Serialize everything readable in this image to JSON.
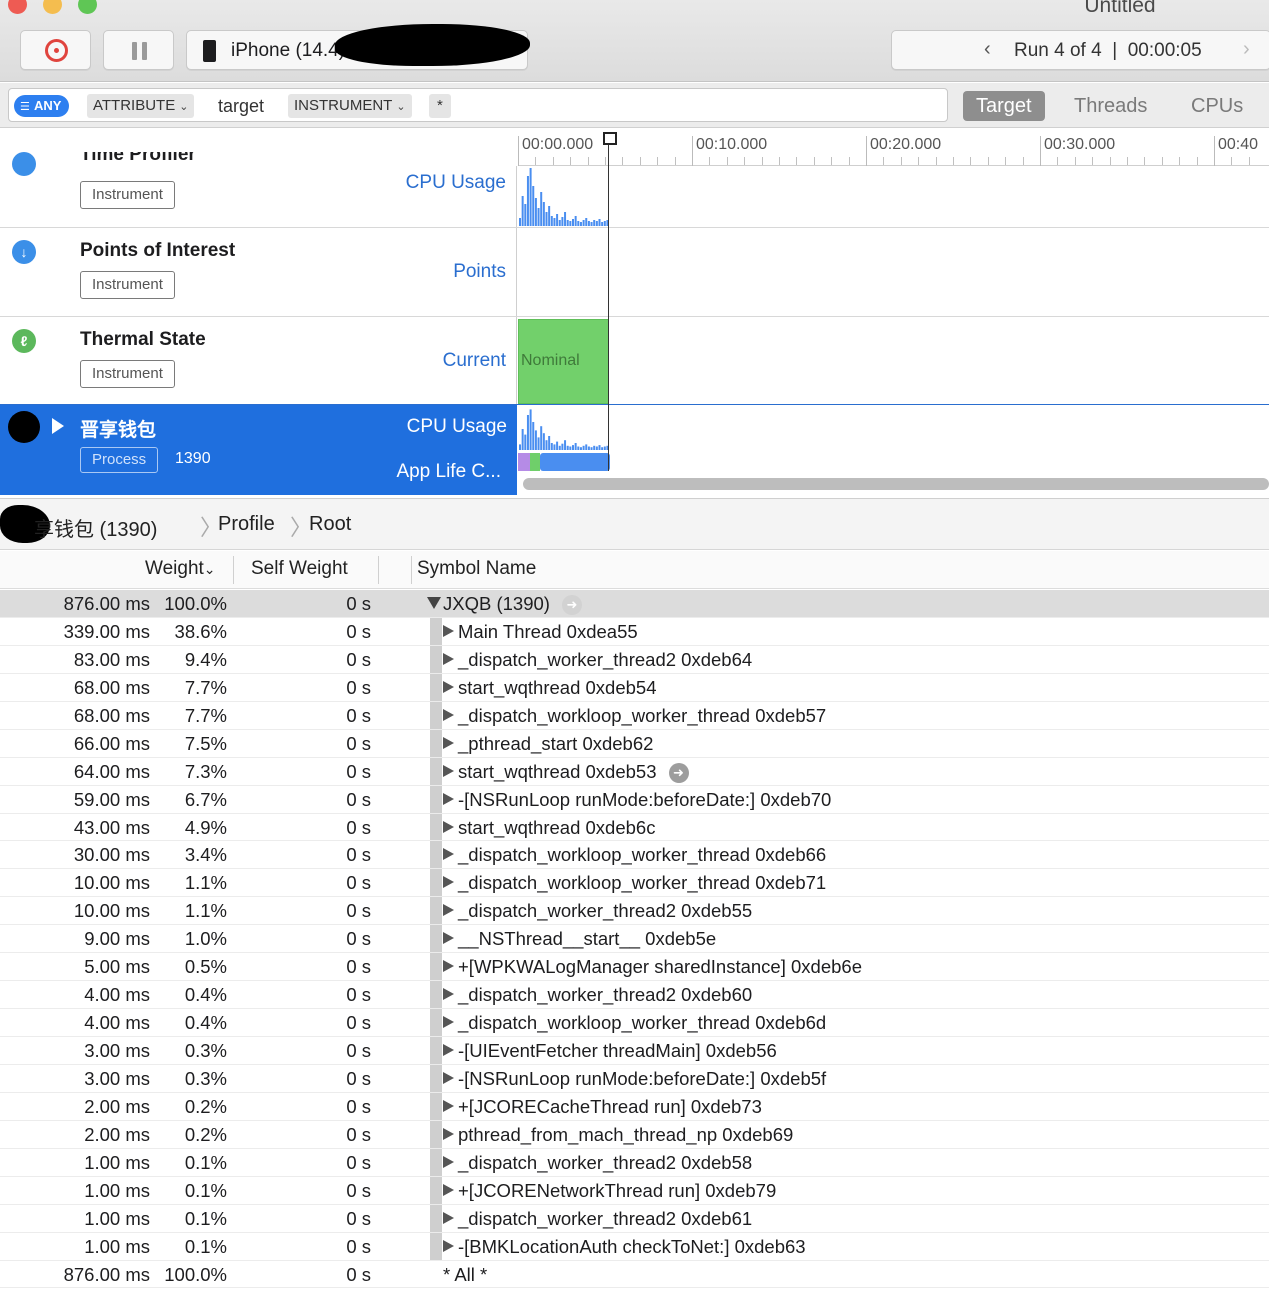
{
  "window": {
    "title": "Untitled"
  },
  "toolbar": {
    "device_label": "iPhone (14.4) ",
    "run_prev": "‹",
    "run_text": "Run 4 of 4  |  00:00:05",
    "run_next": "›"
  },
  "filter": {
    "any_label": "ANY",
    "attribute_label": "ATTRIBUTE",
    "target_text": "target",
    "instrument_label": "INSTRUMENT",
    "wildcard": "*",
    "segments": [
      "Target",
      "Threads",
      "CPUs"
    ]
  },
  "ruler": {
    "ticks": [
      "00:00.000",
      "00:10.000",
      "00:20.000",
      "00:30.000",
      "00:40"
    ]
  },
  "tracks": [
    {
      "name": "Time Profiler",
      "badge": "Instrument",
      "detail": "CPU Usage"
    },
    {
      "name": "Points of Interest",
      "badge": "Instrument",
      "detail": "Points"
    },
    {
      "name": "Thermal State",
      "badge": "Instrument",
      "detail": "Current",
      "state": "Nominal"
    }
  ],
  "process_track": {
    "name": "晋享钱包",
    "badge": "Process",
    "pid": "1390",
    "detail1": "CPU Usage",
    "detail2": "App Life C..."
  },
  "breadcrumb": [
    "享钱包 (1390)",
    "Profile",
    "Root"
  ],
  "table": {
    "headers": {
      "weight": "Weight",
      "self_weight": "Self Weight",
      "symbol": "Symbol Name"
    },
    "rows": [
      {
        "weight": "876.00 ms",
        "pct": "100.0%",
        "self": "0 s",
        "symbol": "JXQB (1390)"
      },
      {
        "weight": "339.00 ms",
        "pct": "38.6%",
        "self": "0 s",
        "symbol": "Main Thread  0xdea55"
      },
      {
        "weight": "83.00 ms",
        "pct": "9.4%",
        "self": "0 s",
        "symbol": "_dispatch_worker_thread2  0xdeb64"
      },
      {
        "weight": "68.00 ms",
        "pct": "7.7%",
        "self": "0 s",
        "symbol": "start_wqthread  0xdeb54"
      },
      {
        "weight": "68.00 ms",
        "pct": "7.7%",
        "self": "0 s",
        "symbol": "_dispatch_workloop_worker_thread  0xdeb57"
      },
      {
        "weight": "66.00 ms",
        "pct": "7.5%",
        "self": "0 s",
        "symbol": "_pthread_start  0xdeb62"
      },
      {
        "weight": "64.00 ms",
        "pct": "7.3%",
        "self": "0 s",
        "symbol": "start_wqthread  0xdeb53"
      },
      {
        "weight": "59.00 ms",
        "pct": "6.7%",
        "self": "0 s",
        "symbol": "-[NSRunLoop runMode:beforeDate:]  0xdeb70"
      },
      {
        "weight": "43.00 ms",
        "pct": "4.9%",
        "self": "0 s",
        "symbol": "start_wqthread  0xdeb6c"
      },
      {
        "weight": "30.00 ms",
        "pct": "3.4%",
        "self": "0 s",
        "symbol": "_dispatch_workloop_worker_thread  0xdeb66"
      },
      {
        "weight": "10.00 ms",
        "pct": "1.1%",
        "self": "0 s",
        "symbol": "_dispatch_workloop_worker_thread  0xdeb71"
      },
      {
        "weight": "10.00 ms",
        "pct": "1.1%",
        "self": "0 s",
        "symbol": "_dispatch_worker_thread2  0xdeb55"
      },
      {
        "weight": "9.00 ms",
        "pct": "1.0%",
        "self": "0 s",
        "symbol": "__NSThread__start__  0xdeb5e"
      },
      {
        "weight": "5.00 ms",
        "pct": "0.5%",
        "self": "0 s",
        "symbol": "+[WPKWALogManager sharedInstance]  0xdeb6e"
      },
      {
        "weight": "4.00 ms",
        "pct": "0.4%",
        "self": "0 s",
        "symbol": "_dispatch_worker_thread2  0xdeb60"
      },
      {
        "weight": "4.00 ms",
        "pct": "0.4%",
        "self": "0 s",
        "symbol": "_dispatch_workloop_worker_thread  0xdeb6d"
      },
      {
        "weight": "3.00 ms",
        "pct": "0.3%",
        "self": "0 s",
        "symbol": "-[UIEventFetcher threadMain]  0xdeb56"
      },
      {
        "weight": "3.00 ms",
        "pct": "0.3%",
        "self": "0 s",
        "symbol": "-[NSRunLoop runMode:beforeDate:]  0xdeb5f"
      },
      {
        "weight": "2.00 ms",
        "pct": "0.2%",
        "self": "0 s",
        "symbol": "+[JCORECacheThread run]  0xdeb73"
      },
      {
        "weight": "2.00 ms",
        "pct": "0.2%",
        "self": "0 s",
        "symbol": "pthread_from_mach_thread_np  0xdeb69"
      },
      {
        "weight": "1.00 ms",
        "pct": "0.1%",
        "self": "0 s",
        "symbol": "_dispatch_worker_thread2  0xdeb58"
      },
      {
        "weight": "1.00 ms",
        "pct": "0.1%",
        "self": "0 s",
        "symbol": "+[JCORENetworkThread run]  0xdeb79"
      },
      {
        "weight": "1.00 ms",
        "pct": "0.1%",
        "self": "0 s",
        "symbol": "_dispatch_worker_thread2  0xdeb61"
      },
      {
        "weight": "1.00 ms",
        "pct": "0.1%",
        "self": "0 s",
        "symbol": "-[BMKLocationAuth checkToNet:]  0xdeb63"
      },
      {
        "weight": "876.00 ms",
        "pct": "100.0%",
        "self": "0 s",
        "symbol": "* All *"
      }
    ]
  },
  "colors": {
    "accent": "#1f6fde",
    "record": "#e0443e",
    "cpu_graph": "#4a8ef0",
    "thermal_nominal": "#72d06b"
  },
  "icons": [
    "record-icon",
    "pause-icon",
    "phone-icon",
    "filter-icon",
    "pin-icon",
    "thermometer-icon",
    "disclosure-triangle-icon",
    "go-arrow-icon"
  ]
}
